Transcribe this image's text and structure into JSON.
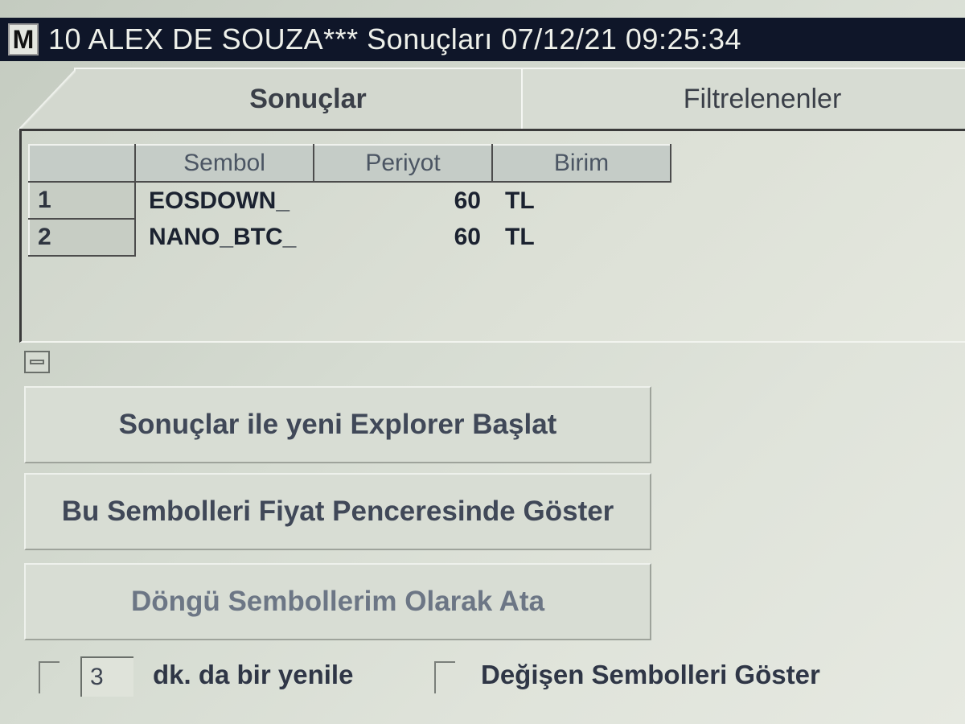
{
  "window": {
    "icon_letter": "M",
    "title": "10 ALEX DE SOUZA*** Sonuçları  07/12/21 09:25:34"
  },
  "tabs": [
    {
      "label": "Sonuçlar",
      "active": true
    },
    {
      "label": "Filtrelenenler",
      "active": false
    }
  ],
  "grid": {
    "columns": [
      "Sembol",
      "Periyot",
      "Birim"
    ],
    "rows": [
      {
        "num": "1",
        "sembol": "EOSDOWN_",
        "periyot": "60",
        "birim": "TL"
      },
      {
        "num": "2",
        "sembol": "NANO_BTC_",
        "periyot": "60",
        "birim": "TL"
      }
    ]
  },
  "actions": {
    "start_explorer": "Sonuçlar ile yeni Explorer Başlat",
    "show_in_price_window": "Bu Sembolleri Fiyat Penceresinde Göster",
    "assign_loop_symbols": "Döngü Sembollerim Olarak Ata"
  },
  "refresh": {
    "minutes": "3",
    "label": "dk. da bir yenile",
    "checked": false
  },
  "show_changing": {
    "label": "Değişen Sembolleri Göster",
    "checked": false
  },
  "colors": {
    "titlebar": "#0f1629",
    "background": "#d6dcd2",
    "text": "#2f3646"
  }
}
